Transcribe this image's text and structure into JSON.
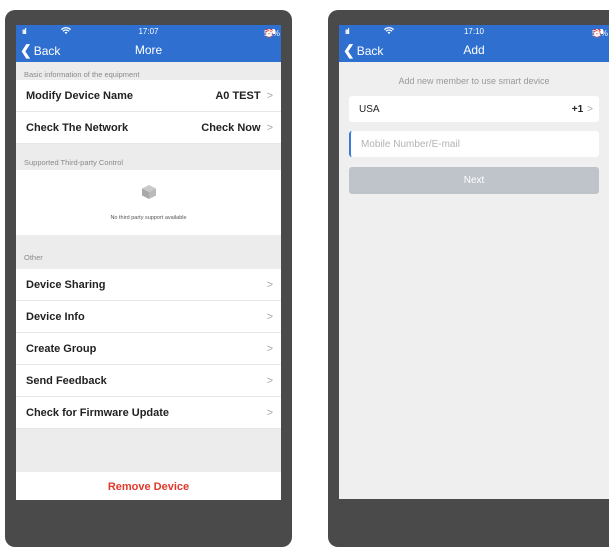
{
  "left_screen": {
    "status": {
      "signal": "ııl",
      "time": "17:07",
      "battery": "52%"
    },
    "nav": {
      "back_label": "Back",
      "title": "More"
    },
    "section_basic": "Basic information of the equipment",
    "modify_name": {
      "label": "Modify Device Name",
      "value": "A0 TEST"
    },
    "network": {
      "label": "Check The Network",
      "value": "Check Now"
    },
    "section_third_party": "Supported Third-party Control",
    "no_third_party": "No third party support available",
    "section_other": "Other",
    "other_items": [
      "Device Sharing",
      "Device Info",
      "Create Group",
      "Send Feedback",
      "Check for Firmware Update"
    ],
    "remove_label": "Remove Device"
  },
  "right_screen": {
    "status": {
      "signal": "ııl",
      "time": "17:10",
      "battery": "51%"
    },
    "nav": {
      "back_label": "Back",
      "title": "Add"
    },
    "hint": "Add new member to use smart device",
    "country": {
      "name": "USA",
      "code": "+1"
    },
    "contact_placeholder": "Mobile Number/E-mail",
    "next_label": "Next"
  },
  "colors": {
    "accent": "#2f6fd0",
    "danger": "#e0392b",
    "disabled_button": "#bfc4cb"
  },
  "icons": [
    "chevron-left-icon",
    "chevron-right-icon",
    "cube-icon",
    "wifi-icon",
    "battery-icon",
    "signal-icon",
    "location-icon",
    "alarm-icon"
  ]
}
